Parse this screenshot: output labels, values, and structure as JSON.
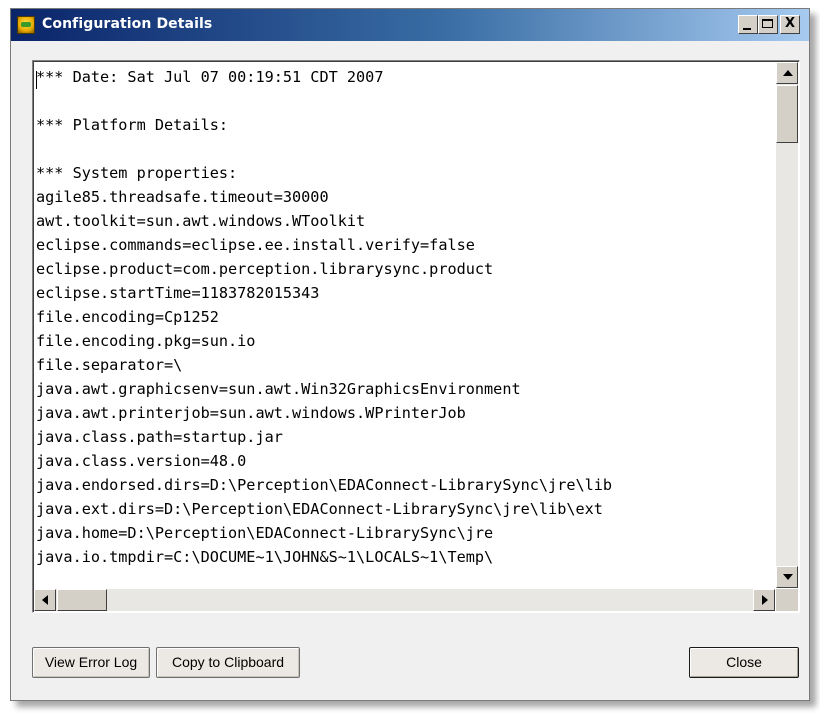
{
  "window": {
    "title": "Configuration Details",
    "controls": {
      "close_glyph": "X"
    }
  },
  "text_area": {
    "lines": [
      "*** Date: Sat Jul 07 00:19:51 CDT 2007",
      "",
      "*** Platform Details:",
      "",
      "*** System properties:",
      "agile85.threadsafe.timeout=30000",
      "awt.toolkit=sun.awt.windows.WToolkit",
      "eclipse.commands=eclipse.ee.install.verify=false",
      "eclipse.product=com.perception.librarysync.product",
      "eclipse.startTime=1183782015343",
      "file.encoding=Cp1252",
      "file.encoding.pkg=sun.io",
      "file.separator=\\",
      "java.awt.graphicsenv=sun.awt.Win32GraphicsEnvironment",
      "java.awt.printerjob=sun.awt.windows.WPrinterJob",
      "java.class.path=startup.jar",
      "java.class.version=48.0",
      "java.endorsed.dirs=D:\\Perception\\EDAConnect-LibrarySync\\jre\\lib",
      "java.ext.dirs=D:\\Perception\\EDAConnect-LibrarySync\\jre\\lib\\ext",
      "java.home=D:\\Perception\\EDAConnect-LibrarySync\\jre",
      "java.io.tmpdir=C:\\DOCUME~1\\JOHN&S~1\\LOCALS~1\\Temp\\"
    ]
  },
  "buttons": {
    "view_error_log": "View Error Log",
    "copy_to_clipboard": "Copy to Clipboard",
    "close": "Close"
  },
  "colors": {
    "titlebar_start": "#0a246a",
    "titlebar_end": "#a6caf0",
    "dialog_face": "#f0f0f0"
  }
}
